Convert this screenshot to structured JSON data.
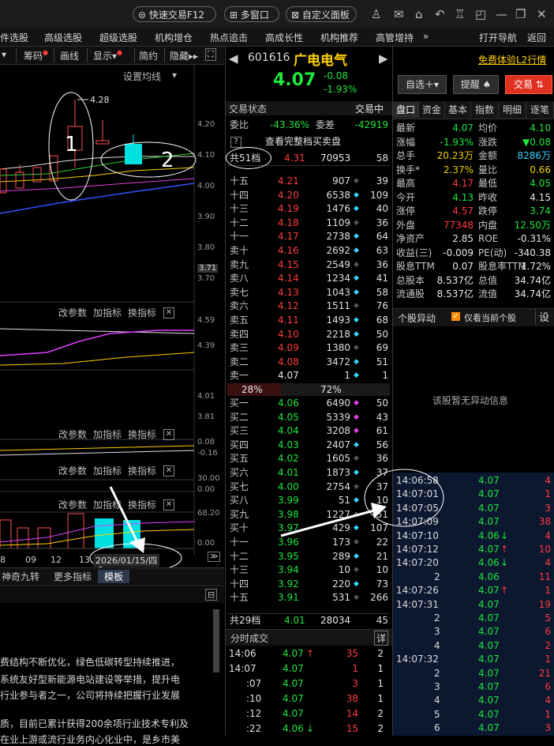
{
  "titlebar": {
    "quick_trade": "快速交易F12",
    "multi_window": "多窗口",
    "custom_panel": "自定义面板"
  },
  "menu": [
    "件选股",
    "高级选股",
    "超级选股",
    "机构增仓",
    "热点追击",
    "高成长性",
    "机构推荐",
    "高管增持",
    "»",
    "打开导航",
    "返回"
  ],
  "chart_toolbar": {
    "chip": "筹码",
    "draw": "画线",
    "show": "显示",
    "simple": "简约",
    "hide": "隐藏"
  },
  "chart": {
    "ma_setting": "设置均线",
    "high_label": "4.28",
    "price_axis": [
      "4.20",
      "4.10",
      "4.00",
      "3.90",
      "3.80",
      "3.71",
      "3.70"
    ],
    "panel2_axis": [
      "4.59",
      "4.39",
      "4.01",
      "3.81"
    ],
    "panel3_axis": [
      "0.08",
      "-0.16"
    ],
    "panel4_axis": [
      "30.00",
      "0.00"
    ],
    "panel5_axis": [
      "68.20",
      "0.00"
    ],
    "panel_controls": {
      "param": "改参数",
      "add": "加指标",
      "switch": "换指标",
      "close": "✕"
    },
    "xaxis": [
      "8",
      "09",
      "12",
      "13"
    ],
    "date_box": "2026/01/15/四",
    "template": "模板",
    "tool_tabs": [
      "神奇九转",
      "更多指标"
    ],
    "annotation_1": "1",
    "annotation_2": "2"
  },
  "news": [
    "费结构不断优化，绿色低碳转型持续推进，",
    "系统友好型新能源电站建设等举措，提升电",
    "行业参与者之一，公司将持续把握行业发展",
    "",
    "质，目前已累计获得200余项行业技术专利及",
    "在业上游或流行业务内心化业中，是乡市美"
  ],
  "stock": {
    "code": "601616",
    "name": "广电电气",
    "price": "4.07",
    "change": "-0.08",
    "change_pct": "-1.93%",
    "free_l2": "免费体验L2行情",
    "watchlist": "自选＋",
    "alert": "提醒",
    "trade": "交易"
  },
  "orderbook": {
    "status_label": "交易状态",
    "status_value": "交易中",
    "wb_label": "委比",
    "wb_value": "-43.36%",
    "wc_label": "委差",
    "wc_value": "-42919",
    "view_full": "查看完整档买卖盘",
    "total_label": "共51档",
    "total_price": "4.31",
    "total_vol": "70953",
    "total_cnt": "58",
    "asks": [
      {
        "lvl": "十五",
        "p": "4.21",
        "v": "907",
        "c": "39"
      },
      {
        "lvl": "十四",
        "p": "4.20",
        "v": "6538",
        "c": "109"
      },
      {
        "lvl": "十三",
        "p": "4.19",
        "v": "1476",
        "c": "40"
      },
      {
        "lvl": "十二",
        "p": "4.18",
        "v": "1109",
        "c": "36"
      },
      {
        "lvl": "十一",
        "p": "4.17",
        "v": "2738",
        "c": "64"
      },
      {
        "lvl": "卖十",
        "p": "4.16",
        "v": "2692",
        "c": "63"
      },
      {
        "lvl": "卖九",
        "p": "4.15",
        "v": "2549",
        "c": "36"
      },
      {
        "lvl": "卖八",
        "p": "4.14",
        "v": "1234",
        "c": "41"
      },
      {
        "lvl": "卖七",
        "p": "4.13",
        "v": "1043",
        "c": "58"
      },
      {
        "lvl": "卖六",
        "p": "4.12",
        "v": "1511",
        "c": "76"
      },
      {
        "lvl": "卖五",
        "p": "4.11",
        "v": "1493",
        "c": "68"
      },
      {
        "lvl": "卖四",
        "p": "4.10",
        "v": "2218",
        "c": "50"
      },
      {
        "lvl": "卖三",
        "p": "4.09",
        "v": "1380",
        "c": "69"
      },
      {
        "lvl": "卖二",
        "p": "4.08",
        "v": "3472",
        "c": "51"
      },
      {
        "lvl": "卖一",
        "p": "4.07",
        "v": "1",
        "c": "1"
      }
    ],
    "ratio_left": "28%",
    "ratio_right": "72%",
    "bids": [
      {
        "lvl": "买一",
        "p": "4.06",
        "v": "6490",
        "c": "50"
      },
      {
        "lvl": "买二",
        "p": "4.05",
        "v": "5339",
        "c": "43"
      },
      {
        "lvl": "买三",
        "p": "4.04",
        "v": "3208",
        "c": "61"
      },
      {
        "lvl": "买四",
        "p": "4.03",
        "v": "2407",
        "c": "56"
      },
      {
        "lvl": "买五",
        "p": "4.02",
        "v": "1605",
        "c": "36"
      },
      {
        "lvl": "买六",
        "p": "4.01",
        "v": "1873",
        "c": "37"
      },
      {
        "lvl": "买七",
        "p": "4.00",
        "v": "2754",
        "c": "37"
      },
      {
        "lvl": "买八",
        "p": "3.99",
        "v": "51",
        "c": "10"
      },
      {
        "lvl": "买九",
        "p": "3.98",
        "v": "1227",
        "c": "51"
      },
      {
        "lvl": "买十",
        "p": "3.97",
        "v": "429",
        "c": "107"
      },
      {
        "lvl": "十一",
        "p": "3.96",
        "v": "173",
        "c": "22"
      },
      {
        "lvl": "十二",
        "p": "3.95",
        "v": "289",
        "c": "21"
      },
      {
        "lvl": "十三",
        "p": "3.94",
        "v": "10",
        "c": "10"
      },
      {
        "lvl": "十四",
        "p": "3.92",
        "v": "220",
        "c": "73"
      },
      {
        "lvl": "十五",
        "p": "3.91",
        "v": "531",
        "c": "266"
      }
    ],
    "bid_total_label": "共29档",
    "bid_total_price": "4.01",
    "bid_total_vol": "28034",
    "bid_total_cnt": "45"
  },
  "trades": {
    "title": "分时成交",
    "detail": "详",
    "rows": [
      {
        "t": "14:06",
        "p": "4.07",
        "arrow": "↑",
        "v": "35",
        "c": "2"
      },
      {
        "t": "14:07",
        "p": "4.07",
        "arrow": "",
        "v": "1",
        "c": "1"
      },
      {
        "t": ":07",
        "p": "4.07",
        "arrow": "",
        "v": "3",
        "c": "1"
      },
      {
        "t": ":10",
        "p": "4.07",
        "arrow": "",
        "v": "38",
        "c": "1"
      },
      {
        "t": ":12",
        "p": "4.07",
        "arrow": "",
        "v": "14",
        "c": "2"
      },
      {
        "t": ":22",
        "p": "4.06",
        "arrow": "↓",
        "v": "15",
        "c": "2"
      }
    ]
  },
  "quote": {
    "tabs": [
      "盘口",
      "资金",
      "基本",
      "指数",
      "明细",
      "逐笔"
    ],
    "rows": [
      [
        "最新",
        "4.07",
        "均价",
        "4.10"
      ],
      [
        "涨幅",
        "-1.93%",
        "涨跌",
        "▼0.08"
      ],
      [
        "总手",
        "20.23万",
        "金额",
        "8286万"
      ],
      [
        "换手*",
        "2.37%",
        "量比",
        "0.66"
      ],
      [
        "最高",
        "4.17",
        "最低",
        "4.05"
      ],
      [
        "今开",
        "4.13",
        "昨收",
        "4.15"
      ],
      [
        "涨停",
        "4.57",
        "跌停",
        "3.74"
      ],
      [
        "外盘",
        "77348",
        "内盘",
        "12.50万"
      ],
      [
        "净资产",
        "2.85",
        "ROE",
        "-0.31%"
      ],
      [
        "收益(三)",
        "-0.009",
        "PE(动)",
        "-340.38"
      ],
      [
        "股息TTM",
        "0.07",
        "股息率TTM",
        "1.72%"
      ],
      [
        "总股本",
        "8.537亿",
        "总值",
        "34.74亿"
      ],
      [
        "流通股",
        "8.537亿",
        "流值",
        "34.74亿"
      ]
    ],
    "anomaly_title": "个股异动",
    "only_current": "仅看当前个股",
    "settings": "设",
    "no_anomaly": "该股暂无异动信息"
  },
  "ticks": [
    {
      "t": "14:06:58",
      "p": "4.07",
      "a": "",
      "v": "4"
    },
    {
      "t": "14:07:01",
      "p": "4.07",
      "a": "",
      "v": "1"
    },
    {
      "t": "14:07:05",
      "p": "4.07",
      "a": "",
      "v": "3"
    },
    {
      "t": "14:07:09",
      "p": "4.07",
      "a": "",
      "v": "38"
    },
    {
      "t": "14:07:10",
      "p": "4.06",
      "a": "↓",
      "v": "4"
    },
    {
      "t": "14:07:12",
      "p": "4.07",
      "a": "↑",
      "v": "10"
    },
    {
      "t": "14:07:20",
      "p": "4.06",
      "a": "↓",
      "v": "4"
    },
    {
      "t": "2",
      "p": "4.06",
      "a": "",
      "v": "11"
    },
    {
      "t": "14:07:26",
      "p": "4.07",
      "a": "↑",
      "v": "1"
    },
    {
      "t": "14:07:31",
      "p": "4.07",
      "a": "",
      "v": "19"
    },
    {
      "t": "2",
      "p": "4.07",
      "a": "",
      "v": "5"
    },
    {
      "t": "3",
      "p": "4.07",
      "a": "",
      "v": "6"
    },
    {
      "t": "4",
      "p": "4.07",
      "a": "",
      "v": "2"
    },
    {
      "t": "14:07:32",
      "p": "4.07",
      "a": "",
      "v": "1"
    },
    {
      "t": "2",
      "p": "4.07",
      "a": "",
      "v": "21"
    },
    {
      "t": "3",
      "p": "4.07",
      "a": "",
      "v": "6"
    },
    {
      "t": "4",
      "p": "4.07",
      "a": "",
      "v": "4"
    },
    {
      "t": "5",
      "p": "4.07",
      "a": "",
      "v": "1"
    },
    {
      "t": "6",
      "p": "4.07",
      "a": "",
      "v": "3"
    }
  ]
}
